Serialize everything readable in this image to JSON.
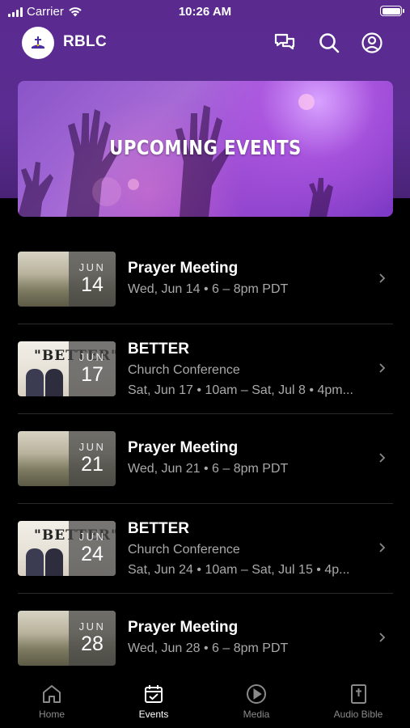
{
  "status_bar": {
    "carrier": "Carrier",
    "time": "10:26 AM"
  },
  "header": {
    "title": "RBLC"
  },
  "banner": {
    "title": "UPCOMING EVENTS"
  },
  "events": [
    {
      "title": "Prayer Meeting",
      "subtitle": "",
      "details": "Wed, Jun 14 • 6 – 8pm PDT",
      "month": "JUN",
      "day": "14",
      "thumb": "field"
    },
    {
      "title": "BETTER",
      "subtitle": "Church Conference",
      "details": "Sat, Jun 17 • 10am – Sat, Jul 8 • 4pm...",
      "month": "JUN",
      "day": "17",
      "thumb": "poster",
      "poster_text": "\"BETTER\""
    },
    {
      "title": "Prayer Meeting",
      "subtitle": "",
      "details": "Wed, Jun 21 • 6 – 8pm PDT",
      "month": "JUN",
      "day": "21",
      "thumb": "field"
    },
    {
      "title": "BETTER",
      "subtitle": "Church Conference",
      "details": "Sat, Jun 24 • 10am – Sat, Jul 15 • 4p...",
      "month": "JUN",
      "day": "24",
      "thumb": "poster",
      "poster_text": "\"BETTER\""
    },
    {
      "title": "Prayer Meeting",
      "subtitle": "",
      "details": "Wed, Jun 28 • 6 – 8pm PDT",
      "month": "JUN",
      "day": "28",
      "thumb": "field"
    }
  ],
  "tabs": [
    {
      "label": "Home",
      "icon": "home-icon",
      "active": false
    },
    {
      "label": "Events",
      "icon": "calendar-icon",
      "active": true
    },
    {
      "label": "Media",
      "icon": "play-icon",
      "active": false
    },
    {
      "label": "Audio Bible",
      "icon": "bible-icon",
      "active": false
    }
  ],
  "colors": {
    "header_bg": "#5a2a8f",
    "background": "#000000",
    "muted_text": "#a9a9a9"
  }
}
